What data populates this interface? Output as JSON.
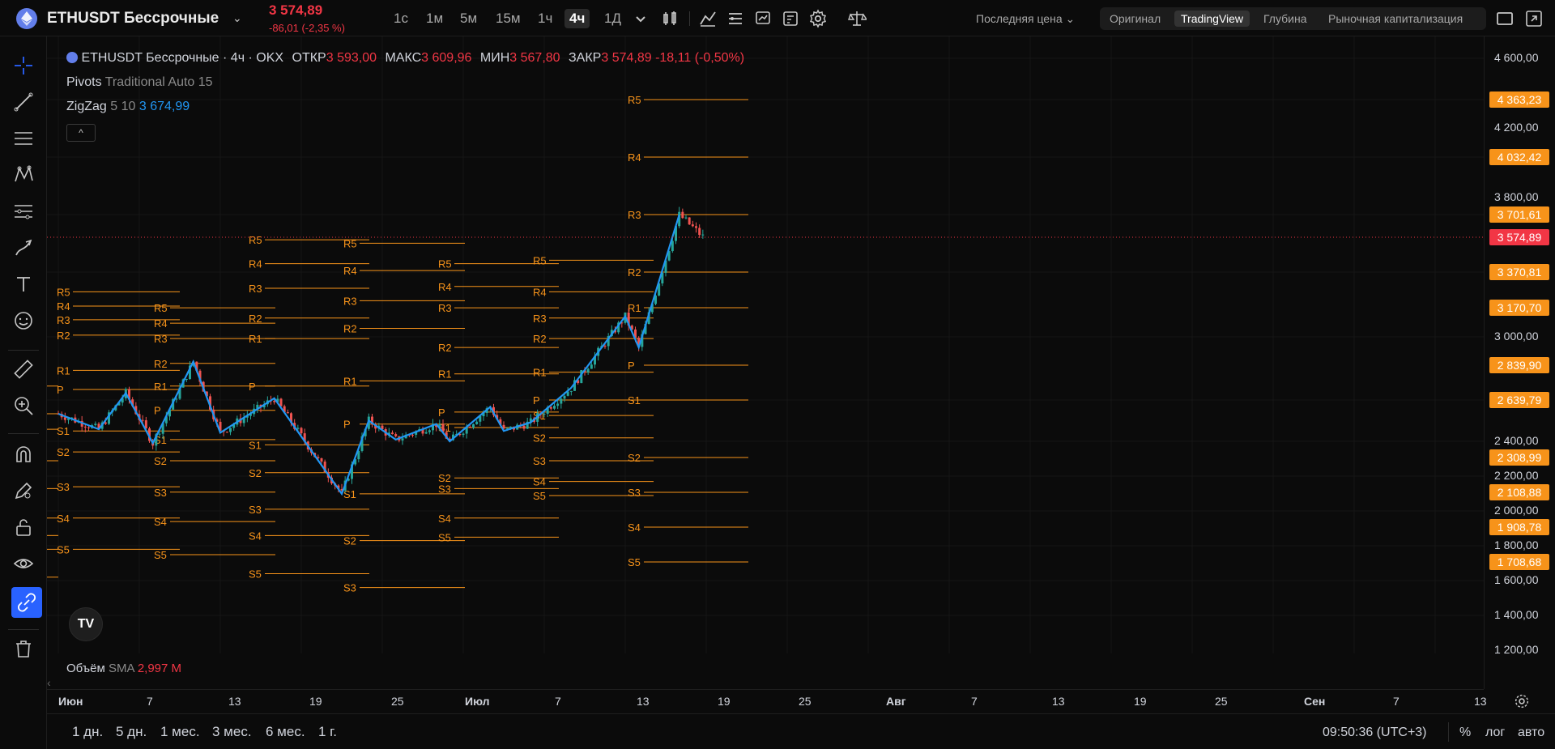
{
  "header": {
    "symbol": "ETHUSDT Бессрочные",
    "last_price": "3 574,89",
    "change": "-86,01 (-2,35 %)",
    "timeframes": [
      "1с",
      "1м",
      "5м",
      "15м",
      "1ч",
      "4ч",
      "1Д"
    ],
    "active_timeframe": "4ч",
    "price_type": "Последняя цена",
    "view_tabs": [
      "Оригинал",
      "TradingView",
      "Глубина",
      "Рыночная капитализация"
    ],
    "active_view": "TradingView"
  },
  "legend": {
    "title": "ETHUSDT Бессрочные · 4ч · OKX",
    "open_label": "ОТКР",
    "open": "3 593,00",
    "high_label": "МАКС",
    "high": "3 609,96",
    "low_label": "МИН",
    "low": "3 567,80",
    "close_label": "ЗАКР",
    "close": "3 574,89",
    "close_change": "-18,11 (-0,50%)",
    "pivots_name": "Pivots",
    "pivots_params": "Traditional Auto 15",
    "zigzag_name": "ZigZag",
    "zigzag_params": "5 10",
    "zigzag_value": "3 674,99",
    "collapse": "^"
  },
  "volume": {
    "name": "Объём",
    "ma": "SMA",
    "value": "2,997 M"
  },
  "price_axis": {
    "ticks": [
      "4 600,00",
      "4 200,00",
      "3 800,00",
      "3 000,00",
      "2 400,00",
      "2 200,00",
      "2 000,00",
      "1 800,00",
      "1 600,00",
      "1 400,00",
      "1 200,00"
    ],
    "tags": [
      "4 363,23",
      "4 032,42",
      "3 701,61",
      "3 370,81",
      "3 170,70",
      "2 839,90",
      "2 639,79",
      "2 308,99",
      "2 108,88",
      "1 908,78",
      "1 708,68"
    ],
    "last_tag": "3 574,89"
  },
  "time_axis": {
    "ticks": [
      "Июн",
      "7",
      "13",
      "19",
      "25",
      "Июл",
      "7",
      "13",
      "19",
      "25",
      "Авг",
      "7",
      "13",
      "19",
      "25",
      "Сен",
      "7",
      "13"
    ]
  },
  "bottom": {
    "ranges": [
      "1 дн.",
      "5 дн.",
      "1 мес.",
      "3 мес.",
      "6 мес.",
      "1 г."
    ],
    "clock": "09:50:36 (UTC+3)",
    "percent": "%",
    "log": "лог",
    "auto": "авто"
  },
  "pivot_labels": [
    "R5",
    "R4",
    "R3",
    "R2",
    "R1",
    "P",
    "S1",
    "S2",
    "S3",
    "S4",
    "S5"
  ],
  "colors": {
    "pivot": "#f7931a",
    "zigzag": "#2196f3",
    "up": "#26a69a",
    "down": "#ef5350",
    "last_price": "#f23645"
  },
  "chart_data": {
    "type": "line",
    "series": [
      {
        "name": "ZigZag",
        "x": [
          "Июн 1",
          "Июн 4",
          "Июн 6",
          "Июн 8",
          "Июн 11",
          "Июн 13",
          "Июн 17",
          "Июн 22",
          "Июн 24",
          "Июн 26",
          "Июн 29",
          "Июн 30",
          "Июл 3",
          "Июл 4",
          "Июл 6",
          "Июл 9",
          "Июл 13",
          "Июл 14",
          "Июл 17"
        ],
        "y": [
          2560,
          2470,
          2680,
          2390,
          2860,
          2450,
          2650,
          2100,
          2520,
          2410,
          2500,
          2400,
          2600,
          2460,
          2510,
          2710,
          3120,
          2940,
          3700
        ]
      }
    ],
    "ylim": [
      1200,
      4600
    ]
  }
}
